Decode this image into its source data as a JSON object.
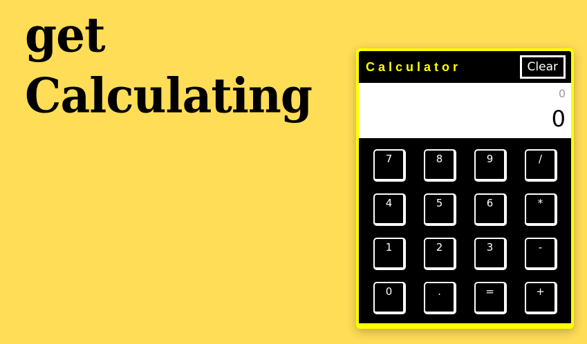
{
  "headline": {
    "line1": "get",
    "line2": "Calculating"
  },
  "calculator": {
    "title": "Calculator",
    "clear_label": "Clear",
    "display": {
      "previous": "0",
      "current": "0"
    },
    "keys": [
      "7",
      "8",
      "9",
      "/",
      "4",
      "5",
      "6",
      "*",
      "1",
      "2",
      "3",
      "-",
      "0",
      ".",
      "=",
      "+"
    ]
  },
  "colors": {
    "background": "#ffdd57",
    "accent": "#ffff00",
    "panel": "#000000",
    "display": "#ffffff"
  }
}
